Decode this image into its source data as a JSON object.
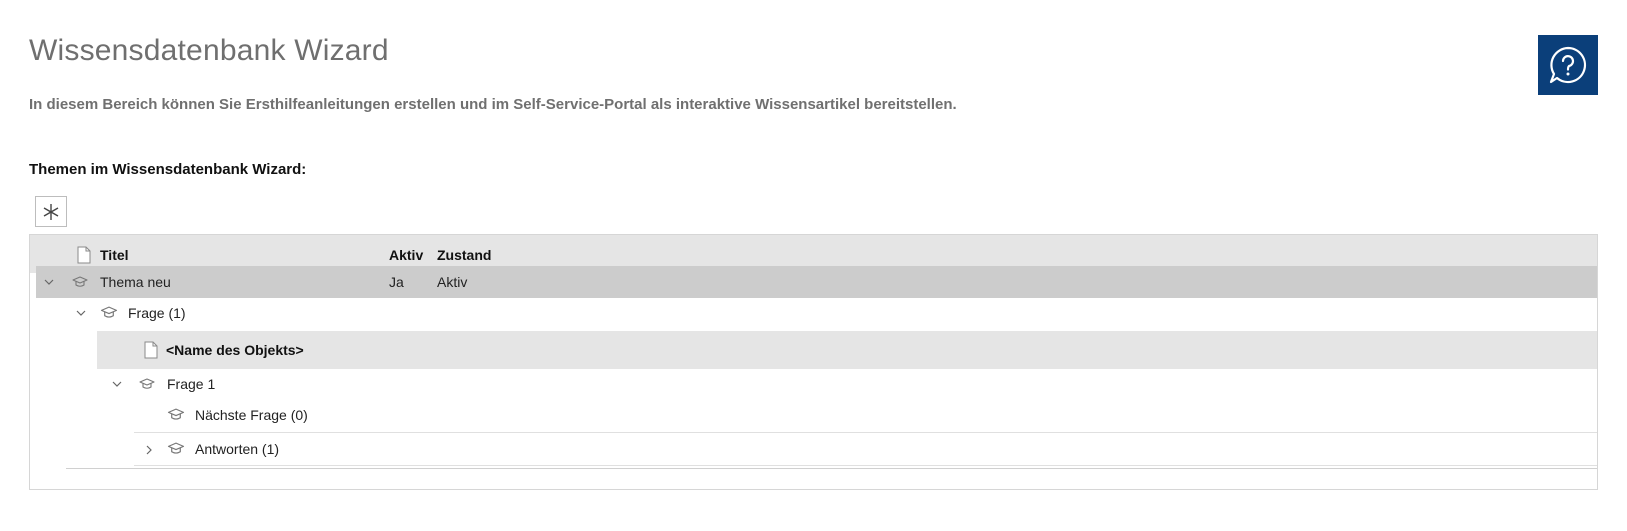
{
  "header": {
    "title": "Wissensdatenbank Wizard",
    "description": "In diesem Bereich können Sie Ersthilfeanleitungen erstellen und im Self-Service-Portal als interaktive Wissensartikel bereitstellen.",
    "help_icon": "help-chat-icon"
  },
  "section": {
    "title": "Themen im Wissensdatenbank Wizard:"
  },
  "toolbar": {
    "new_icon": "asterisk-icon"
  },
  "table": {
    "columns": [
      "Titel",
      "Aktiv",
      "Zustand"
    ],
    "rows": [
      {
        "title": "Thema neu",
        "aktiv": "Ja",
        "zustand": "Aktiv"
      },
      {
        "title": "Frage (1)"
      },
      {
        "title": "<Name des Objekts>"
      },
      {
        "title": "Frage 1"
      },
      {
        "title": "Nächste Frage (0)"
      },
      {
        "title": "Antworten (1)"
      }
    ]
  },
  "colors": {
    "accent": "#0b3f7a",
    "header_bg": "#e5e5e5",
    "selected_row_bg": "#cccccc",
    "object_row_bg": "#e5e5e5"
  }
}
